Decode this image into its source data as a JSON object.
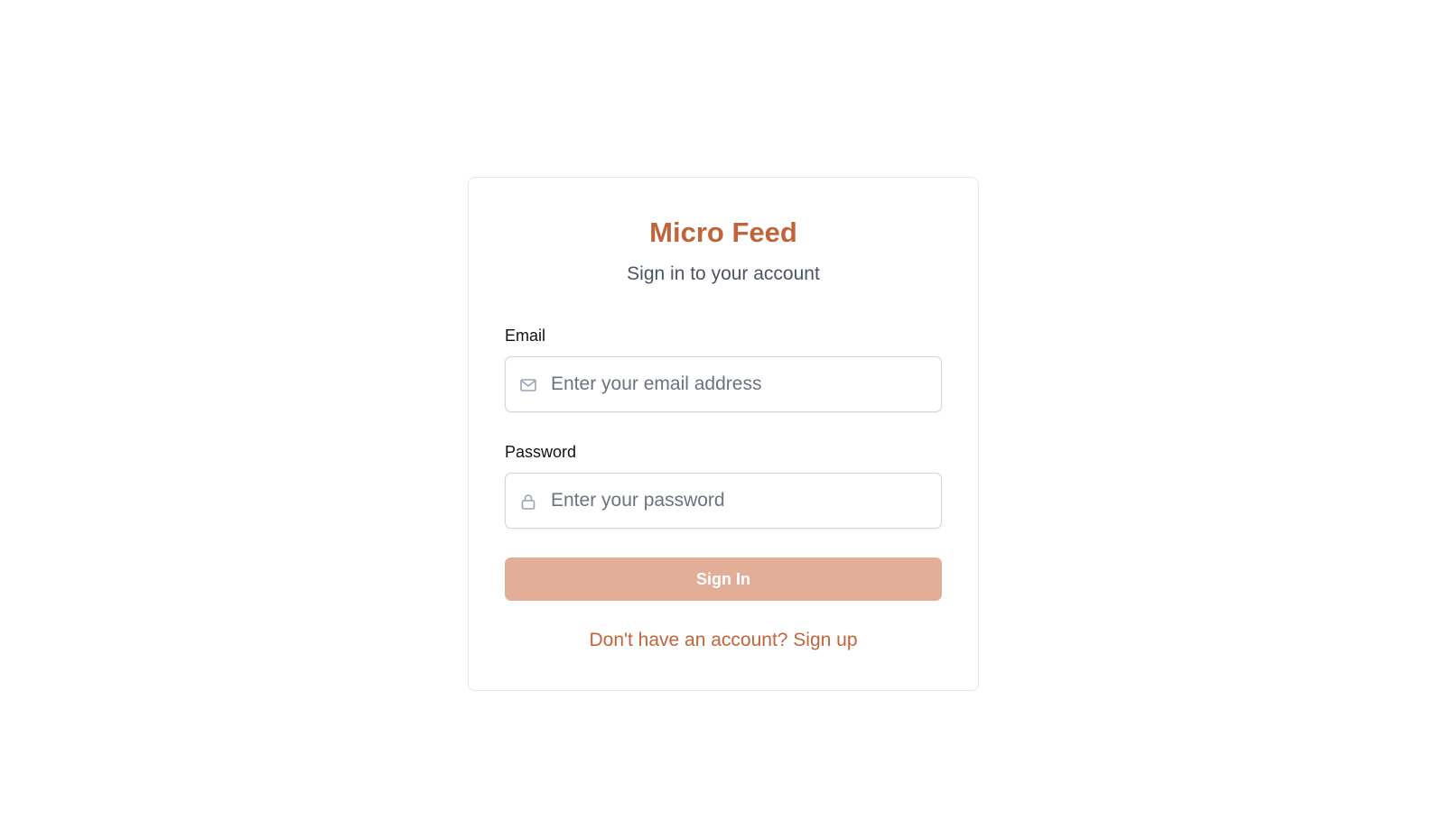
{
  "app": {
    "title": "Micro Feed",
    "subtitle": "Sign in to your account"
  },
  "form": {
    "email": {
      "label": "Email",
      "placeholder": "Enter your email address",
      "value": "",
      "icon": "mail-icon"
    },
    "password": {
      "label": "Password",
      "placeholder": "Enter your password",
      "value": "",
      "icon": "lock-icon"
    },
    "submit_label": "Sign In",
    "signup_link": "Don't have an account? Sign up"
  },
  "colors": {
    "accent": "#c2643a",
    "button_bg": "#e2ae98",
    "muted_text": "#4b5563",
    "border": "#d1d5db"
  }
}
